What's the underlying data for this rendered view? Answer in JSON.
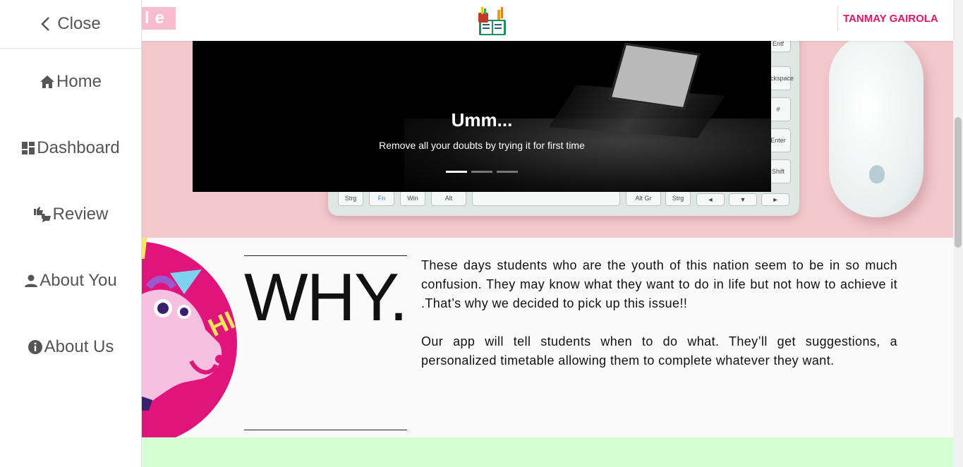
{
  "sidebar": {
    "close_label": "Close",
    "items": [
      {
        "label": "Home",
        "icon": "home-icon"
      },
      {
        "label": "Dashboard",
        "icon": "dashboard-icon"
      },
      {
        "label": "Review",
        "icon": "thumbs-icon"
      },
      {
        "label": "About You",
        "icon": "person-icon"
      },
      {
        "label": "About Us",
        "icon": "info-icon"
      }
    ]
  },
  "header": {
    "brand_fragment": "le",
    "user_name": "TANMAY GAIROLA",
    "accent_color": "#e21566"
  },
  "carousel": {
    "title": "Umm...",
    "subtitle": "Remove all your doubts by trying it for first time",
    "active_slide": 1,
    "slide_count": 3
  },
  "keyboard_keys": [
    "Strg",
    "Fn",
    "Win",
    "Alt",
    "Alt Gr",
    "Strg",
    "◄",
    "▼",
    "►",
    "Entf",
    "Backspace",
    "#",
    "Enter",
    "Shift"
  ],
  "why": {
    "heading": "WHY.",
    "paragraph1": "These days students who are the youth of this nation seem to be in so much confusion. They may know what they want to do in life but not how to achieve it .That’s why we decided to pick up this issue!!",
    "paragraph2": "Our app will tell students when to do what. They’ll get suggestions, a personalized timetable allowing them to complete whatever they want.",
    "unicorn_text": "HI"
  },
  "colors": {
    "hero_bg": "#f2c8cd",
    "green_band": "#d5ffd4",
    "unicorn_circle": "#e0147a"
  }
}
